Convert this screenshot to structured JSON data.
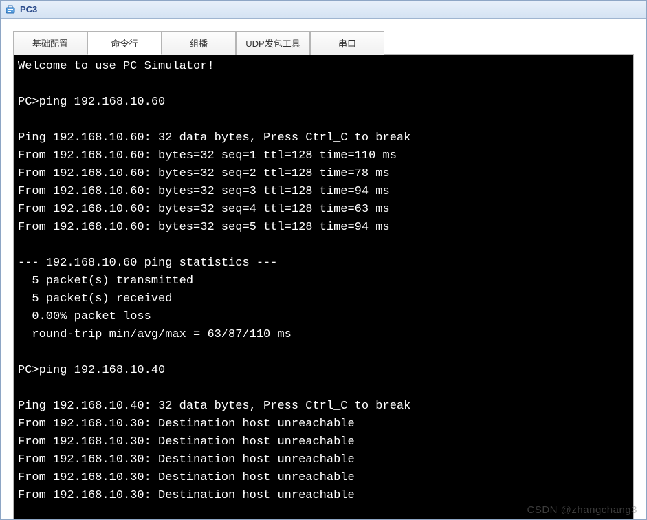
{
  "window": {
    "title": "PC3"
  },
  "tabs": {
    "items": [
      {
        "label": "基础配置"
      },
      {
        "label": "命令行"
      },
      {
        "label": "组播"
      },
      {
        "label": "UDP发包工具"
      },
      {
        "label": "串口"
      }
    ],
    "active_index": 1
  },
  "terminal": {
    "lines": [
      "Welcome to use PC Simulator!",
      "",
      "PC>ping 192.168.10.60",
      "",
      "Ping 192.168.10.60: 32 data bytes, Press Ctrl_C to break",
      "From 192.168.10.60: bytes=32 seq=1 ttl=128 time=110 ms",
      "From 192.168.10.60: bytes=32 seq=2 ttl=128 time=78 ms",
      "From 192.168.10.60: bytes=32 seq=3 ttl=128 time=94 ms",
      "From 192.168.10.60: bytes=32 seq=4 ttl=128 time=63 ms",
      "From 192.168.10.60: bytes=32 seq=5 ttl=128 time=94 ms",
      "",
      "--- 192.168.10.60 ping statistics ---",
      "  5 packet(s) transmitted",
      "  5 packet(s) received",
      "  0.00% packet loss",
      "  round-trip min/avg/max = 63/87/110 ms",
      "",
      "PC>ping 192.168.10.40",
      "",
      "Ping 192.168.10.40: 32 data bytes, Press Ctrl_C to break",
      "From 192.168.10.30: Destination host unreachable",
      "From 192.168.10.30: Destination host unreachable",
      "From 192.168.10.30: Destination host unreachable",
      "From 192.168.10.30: Destination host unreachable",
      "From 192.168.10.30: Destination host unreachable"
    ]
  },
  "watermark": "CSDN @zhangchang3"
}
